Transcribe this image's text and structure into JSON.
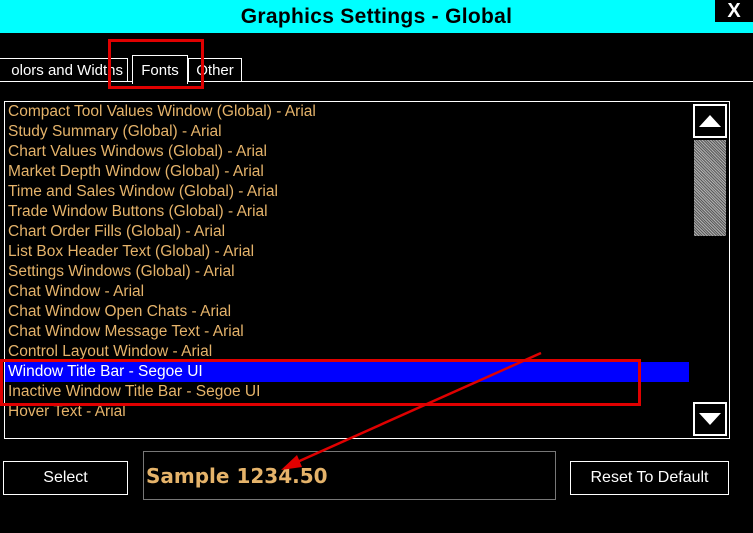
{
  "window": {
    "title": "Graphics Settings - Global",
    "close_label": "X"
  },
  "tabs": [
    {
      "label": "Colors and Widths",
      "visible_text": "olors and Widths",
      "active": false
    },
    {
      "label": "Fonts",
      "active": true
    },
    {
      "label": "Other",
      "active": false
    }
  ],
  "list": {
    "items": [
      {
        "label": "Compact Tool Values Window (Global) - Arial"
      },
      {
        "label": "Study Summary (Global) - Arial"
      },
      {
        "label": "Chart Values Windows (Global) - Arial"
      },
      {
        "label": "Market Depth Window (Global) - Arial"
      },
      {
        "label": "Time and Sales Window (Global) - Arial"
      },
      {
        "label": "Trade Window Buttons (Global) - Arial"
      },
      {
        "label": "Chart Order Fills (Global) - Arial"
      },
      {
        "label": "List Box Header Text (Global) - Arial"
      },
      {
        "label": "Settings Windows (Global) - Arial"
      },
      {
        "label": "Chat Window - Arial"
      },
      {
        "label": "Chat Window Open Chats - Arial"
      },
      {
        "label": "Chat Window Message Text - Arial"
      },
      {
        "label": "Control Layout Window - Arial"
      },
      {
        "label": "Window Title Bar - Segoe UI",
        "selected": true
      },
      {
        "label": "Inactive Window Title Bar - Segoe UI"
      },
      {
        "label": "Hover Text - Arial"
      }
    ],
    "selected_index": 13
  },
  "buttons": {
    "select_label": "Select",
    "reset_label": "Reset To Default"
  },
  "sample": {
    "text": "Sample 1234.50"
  },
  "colors": {
    "titlebar_bg": "#00ffff",
    "list_text": "#e5b36a",
    "selection_bg": "#0000ff",
    "annotation": "#e00000"
  },
  "icons": {
    "scroll_up": "triangle-up-icon",
    "scroll_down": "triangle-down-icon",
    "close": "close-icon"
  }
}
